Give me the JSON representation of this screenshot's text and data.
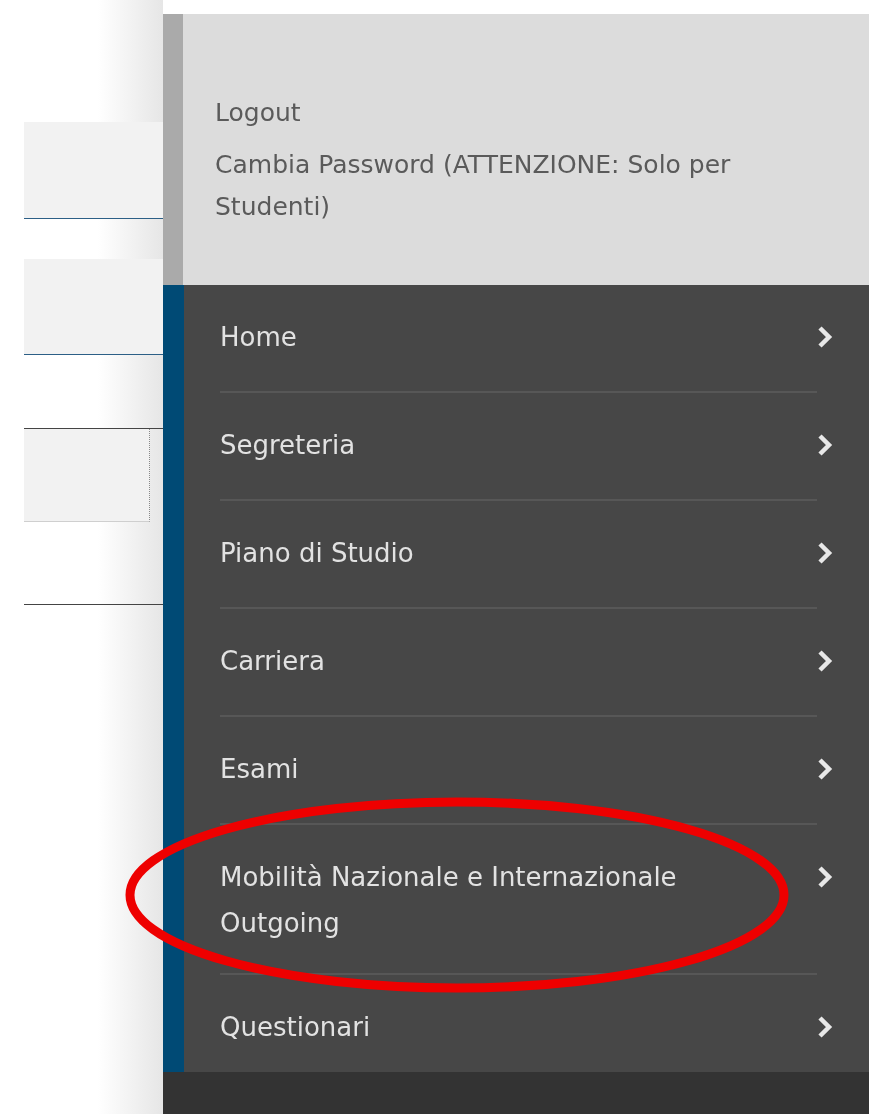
{
  "account_links": [
    {
      "label": "Logout"
    },
    {
      "label": "Cambia Password (ATTENZIONE: Solo per Studenti)"
    }
  ],
  "menu": {
    "items": [
      {
        "label": "Home"
      },
      {
        "label": "Segreteria"
      },
      {
        "label": "Piano di Studio"
      },
      {
        "label": "Carriera"
      },
      {
        "label": "Esami"
      },
      {
        "label": "Mobilità Nazionale e Internazionale Outgoing"
      },
      {
        "label": "Questionari"
      }
    ]
  }
}
